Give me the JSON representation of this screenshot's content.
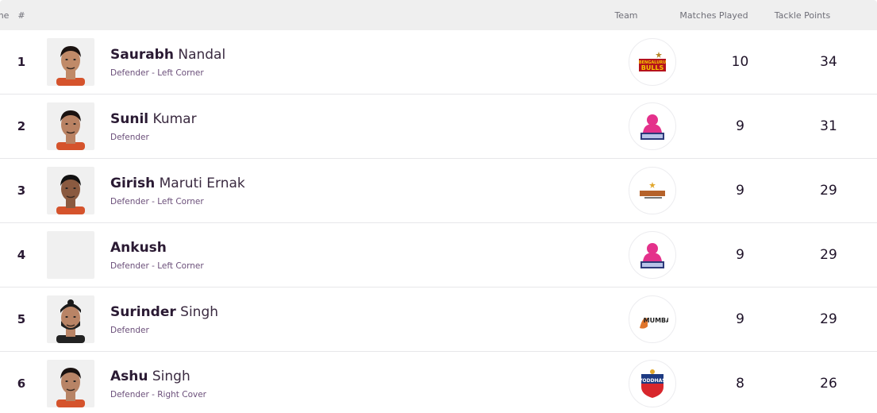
{
  "header": {
    "rank": "#",
    "name": "Name",
    "team": "Team",
    "matches": "Matches Played",
    "tackle": "Tackle Points"
  },
  "colors": {
    "header_bg": "#efefef",
    "text": "#2a1a33",
    "position_text": "#6b4f7a",
    "divider": "#e7e7ea"
  },
  "players": [
    {
      "rank": "1",
      "first": "Saurabh",
      "last": "Nandal",
      "position": "Defender - Left Corner",
      "team_logo": "bengaluru-bulls-logo",
      "photo": "player-photo",
      "matches": "10",
      "tackle_points": "34"
    },
    {
      "rank": "2",
      "first": "Sunil",
      "last": "Kumar",
      "position": "Defender",
      "team_logo": "jaipur-pink-panthers-logo",
      "photo": "player-photo",
      "matches": "9",
      "tackle_points": "31"
    },
    {
      "rank": "3",
      "first": "Girish",
      "last": "Maruti Ernak",
      "position": "Defender - Left Corner",
      "team_logo": "gujarat-giants-logo",
      "photo": "player-photo",
      "matches": "9",
      "tackle_points": "29"
    },
    {
      "rank": "4",
      "first": "Ankush",
      "last": "",
      "position": "Defender - Left Corner",
      "team_logo": "jaipur-pink-panthers-logo",
      "photo": "placeholder",
      "matches": "9",
      "tackle_points": "29"
    },
    {
      "rank": "5",
      "first": "Surinder",
      "last": "Singh",
      "position": "Defender",
      "team_logo": "u-mumba-logo",
      "photo": "player-photo",
      "matches": "9",
      "tackle_points": "29"
    },
    {
      "rank": "6",
      "first": "Ashu",
      "last": "Singh",
      "position": "Defender - Right Cover",
      "team_logo": "up-yoddhas-logo",
      "photo": "player-photo",
      "matches": "8",
      "tackle_points": "26"
    }
  ]
}
